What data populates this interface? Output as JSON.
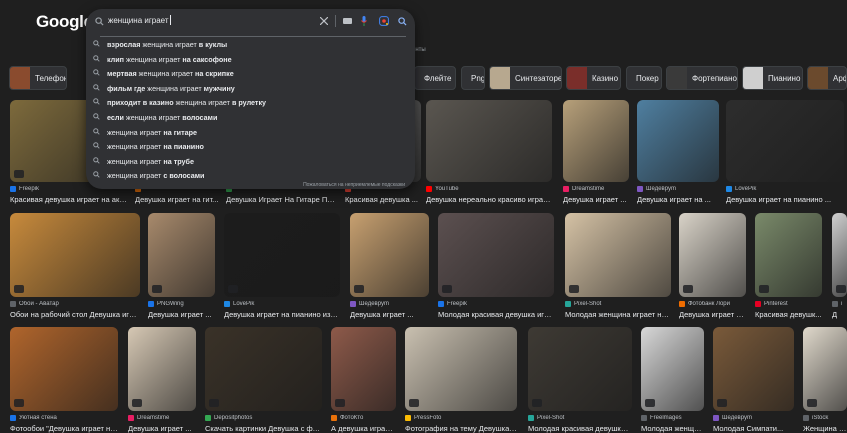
{
  "logo": "Google",
  "search": {
    "query": "женщина играет",
    "suggestions": [
      {
        "pre": "взрослая ",
        "mid": "женщина играет",
        "post": " в куклы"
      },
      {
        "pre": "клип ",
        "mid": "женщина играет",
        "post": " на саксофоне"
      },
      {
        "pre": "мертвая ",
        "mid": "женщина играет",
        "post": " на скрипке"
      },
      {
        "pre": "фильм где ",
        "mid": "женщина играет",
        "post": " мужчину"
      },
      {
        "pre": "приходит в казино ",
        "mid": "женщина играет",
        "post": " в рулетку"
      },
      {
        "pre": "если ",
        "mid": "женщина играет",
        "post": " волосами"
      },
      {
        "pre": "",
        "mid": "женщина играет",
        "post": " на гитаре"
      },
      {
        "pre": "",
        "mid": "женщина играет",
        "post": " на пианино"
      },
      {
        "pre": "",
        "mid": "женщина играет",
        "post": " на трубе"
      },
      {
        "pre": "",
        "mid": "женщина играет",
        "post": " с волосами"
      }
    ],
    "report_text": "Пожаловаться на неприемлемые подсказки",
    "behind_text": "енты"
  },
  "chips": [
    {
      "label": "Телефон",
      "thumb": true,
      "color": "#8a4b2e"
    },
    {
      "label": "Флейте",
      "thumb": false
    },
    {
      "label": "Png",
      "thumb": false
    },
    {
      "label": "Синтезаторе",
      "thumb": true,
      "color": "#b7a88f"
    },
    {
      "label": "Казино",
      "thumb": true,
      "color": "#7a2e2a"
    },
    {
      "label": "Покер",
      "thumb": false
    },
    {
      "label": "Фортепиано",
      "thumb": true,
      "color": "#3a3a3a"
    },
    {
      "label": "Пианино",
      "thumb": true,
      "color": "#cfcfcf"
    },
    {
      "label": "Арфе",
      "thumb": true,
      "color": "#6b4a2d"
    }
  ],
  "rows": [
    [
      {
        "source": "Freepik",
        "title": "Красивая девушка играет на акус...",
        "color": "#7d6a3c",
        "src_color": "#1a73e8"
      },
      {
        "source": "",
        "title": "Девушка играет на гит...",
        "color": "#9b8a78",
        "src_color": "#e8710a"
      },
      {
        "source": "",
        "title": "Девушка Играет На Гитаре Приро...",
        "color": "#555",
        "src_color": "#34a853"
      },
      {
        "source": "",
        "title": "Красивая девушка ...",
        "color": "#6a6a6a",
        "src_color": "#ea4335"
      },
      {
        "source": "YouTube",
        "title": "Девушка нереально красиво играет ...",
        "color": "#5a5650",
        "src_color": "#ff0000"
      },
      {
        "source": "Dreamstime",
        "title": "Девушка играет ...",
        "color": "#b7a07a",
        "src_color": "#e91e63"
      },
      {
        "source": "Шедевруm",
        "title": "Девушка играет на ...",
        "color": "#4f7fa0",
        "src_color": "#7e57c2"
      },
      {
        "source": "LovePik",
        "title": "Девушка играет на пианино ...",
        "color": "#2d2d2d",
        "src_color": "#1e88e5"
      }
    ],
    [
      {
        "source": "Обои - Аватар",
        "title": "Обои на рабочий стол Девушка играе...",
        "color": "#c78a3c",
        "src_color": "#5f6368"
      },
      {
        "source": "PNGWing",
        "title": "Девушка играет ...",
        "color": "#a88a6c",
        "src_color": "#1a73e8"
      },
      {
        "source": "LovePik",
        "title": "Девушка играет на пианино изобр...",
        "color": "#1c1c1c",
        "src_color": "#1e88e5"
      },
      {
        "source": "Шедевруm",
        "title": "Девушка играет ...",
        "color": "#c7a070",
        "src_color": "#7e57c2"
      },
      {
        "source": "Freepik",
        "title": "Молодая красивая девушка играе...",
        "color": "#5c5050",
        "src_color": "#1a73e8"
      },
      {
        "source": "Pixel-Shot",
        "title": "Молодая женщина играет на ...",
        "color": "#d5c2a5",
        "src_color": "#26a69a"
      },
      {
        "source": "Фотобанк Лори",
        "title": "Девушка играет д...",
        "color": "#d9d3c8",
        "src_color": "#ef6c00"
      },
      {
        "source": "Pinterest",
        "title": "Красивая девушк...",
        "color": "#7a8a6a",
        "src_color": "#e60023"
      },
      {
        "source": "i",
        "title": "Д",
        "color": "#d0d0d0",
        "src_color": "#5f6368"
      }
    ],
    [
      {
        "source": "Уютная стена",
        "title": "Фотообои \"Девушка играет на ...",
        "color": "#b0652c",
        "src_color": "#1a73e8"
      },
      {
        "source": "Dreamstime",
        "title": "Девушка играет ...",
        "color": "#d6c8b4",
        "src_color": "#e91e63"
      },
      {
        "source": "Depositphotos",
        "title": "Скачать картинки Девушка с фле...",
        "color": "#3a3228",
        "src_color": "#34a853"
      },
      {
        "source": "ФотоКто",
        "title": "А девушка играет ...",
        "color": "#8e5a4a",
        "src_color": "#e8710a"
      },
      {
        "source": "PressFoto",
        "title": "Фотография на тему Девушка игр...",
        "color": "#c9c0b0",
        "src_color": "#fbbc04"
      },
      {
        "source": "Pixel-Shot",
        "title": "Молодая красивая девушка играет ...",
        "color": "#3e3a34",
        "src_color": "#26a69a"
      },
      {
        "source": "Freelmages",
        "title": "Молодая женщин...",
        "color": "#d8d8d8",
        "src_color": "#5f6368"
      },
      {
        "source": "Шедевруm",
        "title": "Молодая Симпати...",
        "color": "#7a5a3a",
        "src_color": "#7e57c2"
      },
      {
        "source": "iStock",
        "title": "Женщина играет в ...",
        "color": "#e0d9cc",
        "src_color": "#5f6368"
      }
    ]
  ]
}
